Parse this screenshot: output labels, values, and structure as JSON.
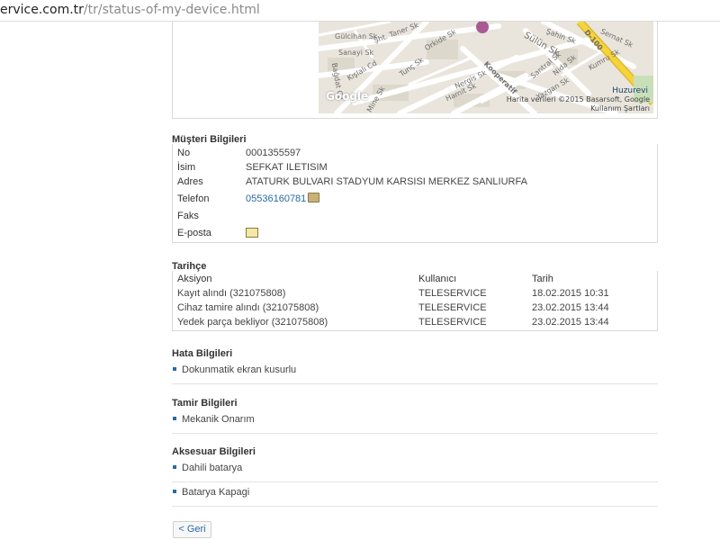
{
  "browser": {
    "url_host": "ervice.com.tr",
    "url_path": "/tr/status-of-my-device.html"
  },
  "map": {
    "streets": [
      "Gülcihan Sk",
      "Sanayi Sk",
      "Şht. Taner Sk",
      "Kışlalı Cd",
      "Orkide Sk",
      "Tunç Sk",
      "Bağdat Cd",
      "Mine Sk",
      "Hamit Sk",
      "Nergis Sk",
      "Kooperatif",
      "Sülün Sk",
      "Şahin Sk",
      "Santral Sk",
      "Nida Sk",
      "Sernat Sk",
      "Kumru Sk",
      "D-100",
      "Yazgan Sk"
    ],
    "poi": "Huzurevi",
    "attribution": "Harita verileri ©2015 Basarsoft, Google",
    "terms": "Kullanım Şartları",
    "google": "Google"
  },
  "customer": {
    "title": "Müşteri Bilgileri",
    "rows": [
      {
        "label": "No",
        "value": "0001355597"
      },
      {
        "label": "İsim",
        "value": "SEFKAT ILETISIM"
      },
      {
        "label": "Adres",
        "value": "ATATURK BULVARI STADYUM KARSISI  MERKEZ SANLIURFA"
      },
      {
        "label": "Telefon",
        "value": "05536160781"
      },
      {
        "label": "Faks",
        "value": ""
      },
      {
        "label": "E-posta",
        "value": ""
      }
    ]
  },
  "history": {
    "title": "Tarihçe",
    "columns": [
      "Aksiyon",
      "Kullanıcı",
      "Tarih"
    ],
    "rows": [
      [
        "Kayıt alındı (321075808)",
        "TELESERVICE",
        "18.02.2015 10:31"
      ],
      [
        "Cihaz tamire alındı (321075808)",
        "TELESERVICE",
        "23.02.2015 13:44"
      ],
      [
        "Yedek parça bekliyor (321075808)",
        "TELESERVICE",
        "23.02.2015 13:44"
      ]
    ]
  },
  "fault": {
    "title": "Hata Bilgileri",
    "items": [
      "Dokunmatik ekran kusurlu"
    ]
  },
  "repair": {
    "title": "Tamir Bilgileri",
    "items": [
      "Mekanik Onarım"
    ]
  },
  "accessory": {
    "title": "Aksesuar Bilgileri",
    "items": [
      "Dahili batarya",
      "Batarya Kapagi"
    ]
  },
  "back_button": "< Geri",
  "colors": {
    "link": "#2a6aa6",
    "map_bg": "#e9e5dc",
    "highway": "#f5d33a"
  }
}
